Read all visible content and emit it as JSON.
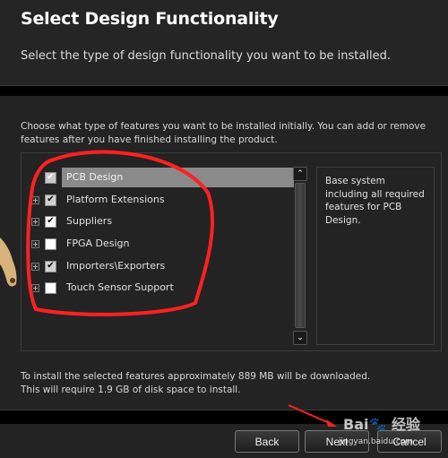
{
  "header": {
    "title": "Select Design Functionality",
    "subtitle": "Select the type of design functionality you want to be installed."
  },
  "content": {
    "intro": "Choose what type of features you want to be installed initially. You can add or remove features after you have finished installing the product.",
    "features": [
      {
        "label": "PCB Design",
        "checked": true,
        "expandable": false,
        "selected": true,
        "check_mark": "✔"
      },
      {
        "label": "Platform Extensions",
        "checked": true,
        "expandable": true,
        "selected": false,
        "check_mark": "✔"
      },
      {
        "label": "Suppliers",
        "checked": true,
        "expandable": true,
        "selected": false,
        "check_mark": "✔"
      },
      {
        "label": "FPGA Design",
        "checked": false,
        "expandable": true,
        "selected": false,
        "check_mark": ""
      },
      {
        "label": "Importers\\Exporters",
        "checked": true,
        "expandable": true,
        "selected": false,
        "check_mark": "✔"
      },
      {
        "label": "Touch Sensor Support",
        "checked": false,
        "expandable": true,
        "selected": false,
        "check_mark": ""
      }
    ],
    "description": "Base system including all required features for PCB Design.",
    "scroll_up_glyph": "⌃",
    "scroll_down_glyph": "⌄",
    "info_line1": "To install the selected features approximately 889 MB will be downloaded.",
    "info_line2": "This will require 1.9 GB of disk space to install."
  },
  "footer": {
    "back_label": "Back",
    "next_label": "Next",
    "cancel_label": "Cancel"
  },
  "watermark": {
    "brand": "Bai🐾 经验",
    "url": "jingyan.baidu.com"
  },
  "colors": {
    "annotation": "#ff2020",
    "selection": "#8a8a8a"
  }
}
